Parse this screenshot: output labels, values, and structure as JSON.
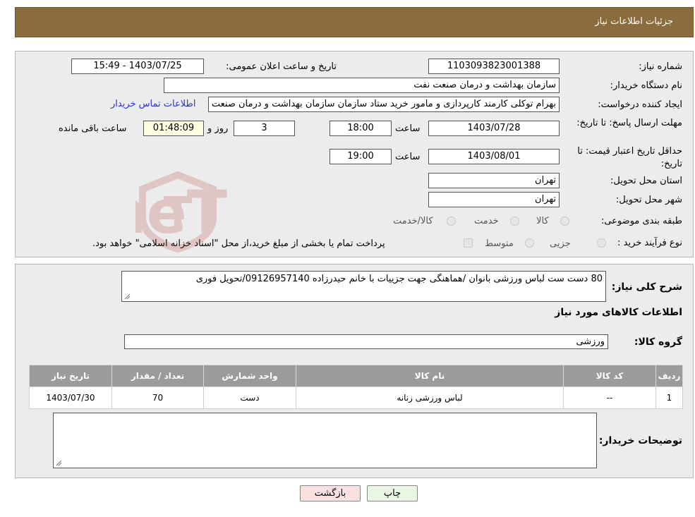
{
  "header": {
    "title": "جزئیات اطلاعات نیاز"
  },
  "details": {
    "need_number_label": "شماره نیاز:",
    "need_number": "1103093823001388",
    "announce_label": "تاریخ و ساعت اعلان عمومی:",
    "announce_value": "1403/07/25 - 15:49",
    "buyer_org_label": "نام دستگاه خریدار:",
    "buyer_org": "سازمان بهداشت و درمان صنعت نفت",
    "requester_label": "ایجاد کننده درخواست:",
    "requester": "بهرام توکلی کارمند کارپردازی و مامور خرید ستاد سازمان سازمان بهداشت و درمان صنعت نفت",
    "contact_link": "اطلاعات تماس خریدار",
    "reply_deadline_label": "مهلت ارسال پاسخ: تا تاریخ:",
    "reply_date": "1403/07/28",
    "time_label": "ساعت",
    "reply_time": "18:00",
    "days_count": "3",
    "days_label": "روز و",
    "remaining_time": "01:48:09",
    "remaining_label": "ساعت باقی مانده",
    "price_validity_label": "حداقل تاریخ اعتبار قیمت: تا تاریخ:",
    "price_date": "1403/08/01",
    "price_time": "19:00",
    "province_label": "استان محل تحویل:",
    "province": "تهران",
    "city_label": "شهر محل تحویل:",
    "city": "تهران",
    "category_label": "طبقه بندی موضوعی:",
    "category_options": [
      "کالا",
      "خدمت",
      "کالا/خدمت"
    ],
    "process_label": "نوع فرآیند خرید :",
    "process_options": [
      "جزیی",
      "متوسط"
    ],
    "payment_note": "پرداخت تمام یا بخشی از مبلغ خرید،از محل \"اسناد خزانه اسلامی\" خواهد بود."
  },
  "description": {
    "label": "شرح کلی نیاز:",
    "text": "80 دست ست لباس ورزشی بانوان /هماهنگی جهت جزییات با خانم حیدرزاده 09126957140/تحویل فوری",
    "goods_info_title": "اطلاعات کالاهای مورد نیاز",
    "goods_group_label": "گروه کالا:",
    "goods_group": "ورزشی"
  },
  "table": {
    "headers": [
      "ردیف",
      "کد کالا",
      "نام کالا",
      "واحد شمارش",
      "تعداد / مقدار",
      "تاریخ نیاز"
    ],
    "rows": [
      [
        "1",
        "--",
        "لباس ورزشی زنانه",
        "دست",
        "70",
        "1403/07/30"
      ]
    ]
  },
  "buyer_notes": {
    "label": "توضیحات خریدار:",
    "text": ""
  },
  "buttons": {
    "print": "چاپ",
    "back": "بازگشت"
  },
  "watermark": {
    "text": "AriaTender.neT",
    "color": "#b0302a"
  }
}
